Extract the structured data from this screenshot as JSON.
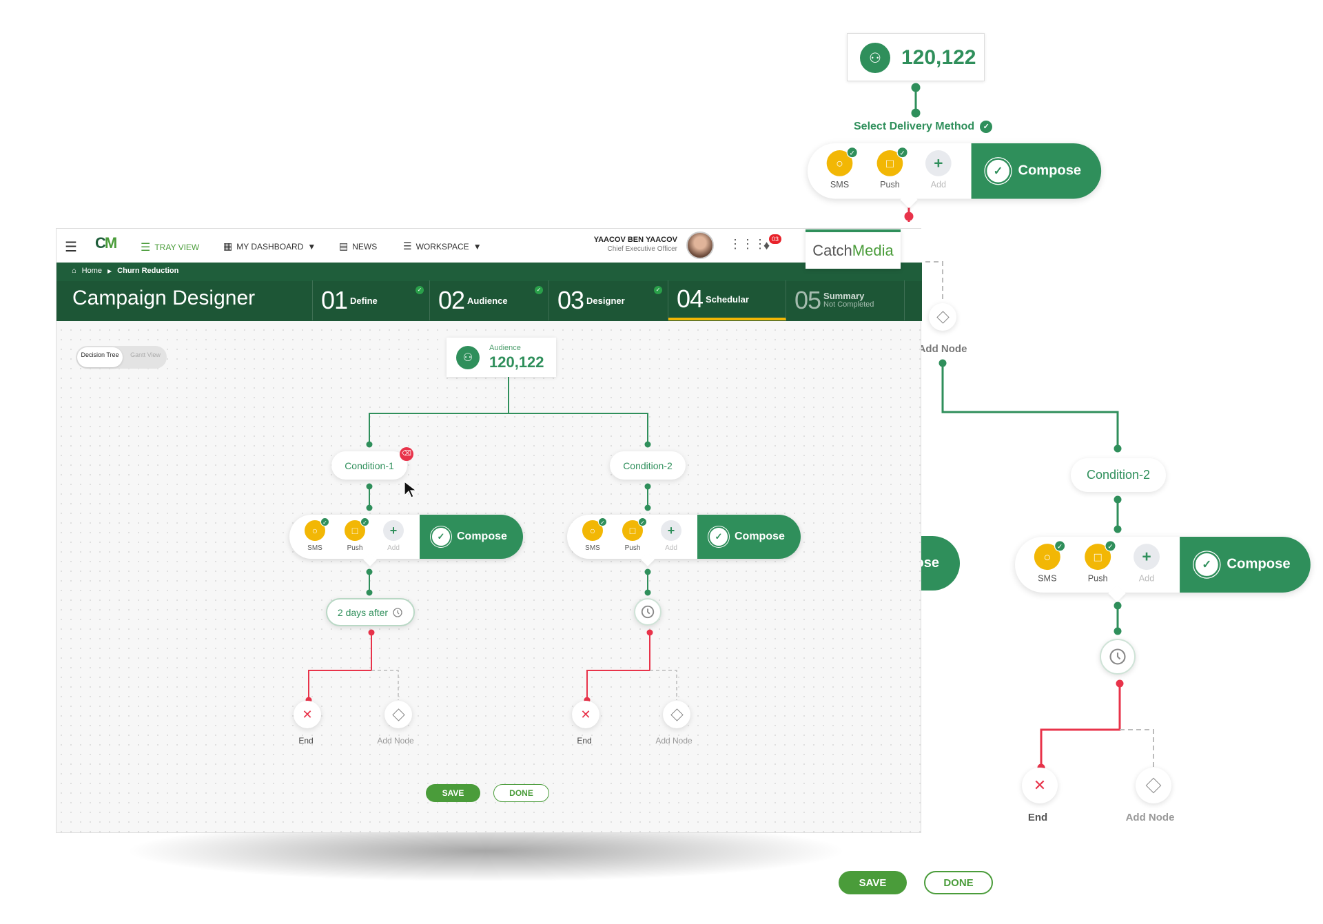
{
  "colors": {
    "accent": "#2f8f5b",
    "header_green": "#1f5e3b",
    "yellow": "#f2b705",
    "red": "#e8334a"
  },
  "nav": {
    "tray_view": "TRAY VIEW",
    "my_dashboard": "MY DASHBOARD",
    "news": "NEWS",
    "workspace": "WORKSPACE",
    "user_name": "YAACOV BEN YAACOV",
    "user_title": "Chief Executive Officer",
    "notifications": "03",
    "brand_catch": "Catch",
    "brand_media": "Media"
  },
  "breadcrumb": {
    "home": "Home",
    "current": "Churn Reduction"
  },
  "steps": {
    "title": "Campaign Designer",
    "items": [
      {
        "num": "01",
        "label": "Define",
        "done": true
      },
      {
        "num": "02",
        "label": "Audience",
        "done": true
      },
      {
        "num": "03",
        "label": "Designer",
        "done": true
      },
      {
        "num": "04",
        "label": "Schedular",
        "active": true
      },
      {
        "num": "05",
        "label": "Summary",
        "sub": "Not Completed"
      }
    ]
  },
  "toggle": {
    "option1": "Decision Tree",
    "option2": "Gantt View",
    "selected": "Decision Tree"
  },
  "canvas": {
    "audience_label": "Audience",
    "audience_count": "120,122",
    "condition1": "Condition-1",
    "condition2": "Condition-2",
    "delay": "2 days after",
    "end": "End",
    "add_node": "Add Node",
    "save": "SAVE",
    "done": "DONE"
  },
  "cards": {
    "sms": "SMS",
    "push": "Push",
    "add": "Add",
    "compose": "Compose"
  },
  "overlay": {
    "audience_count": "120,122",
    "select_delivery": "Select Delivery Method",
    "add_node": "Add Node",
    "condition2": "Condition-2",
    "end": "End",
    "save": "SAVE",
    "done": "DONE",
    "compose": "Compose"
  }
}
